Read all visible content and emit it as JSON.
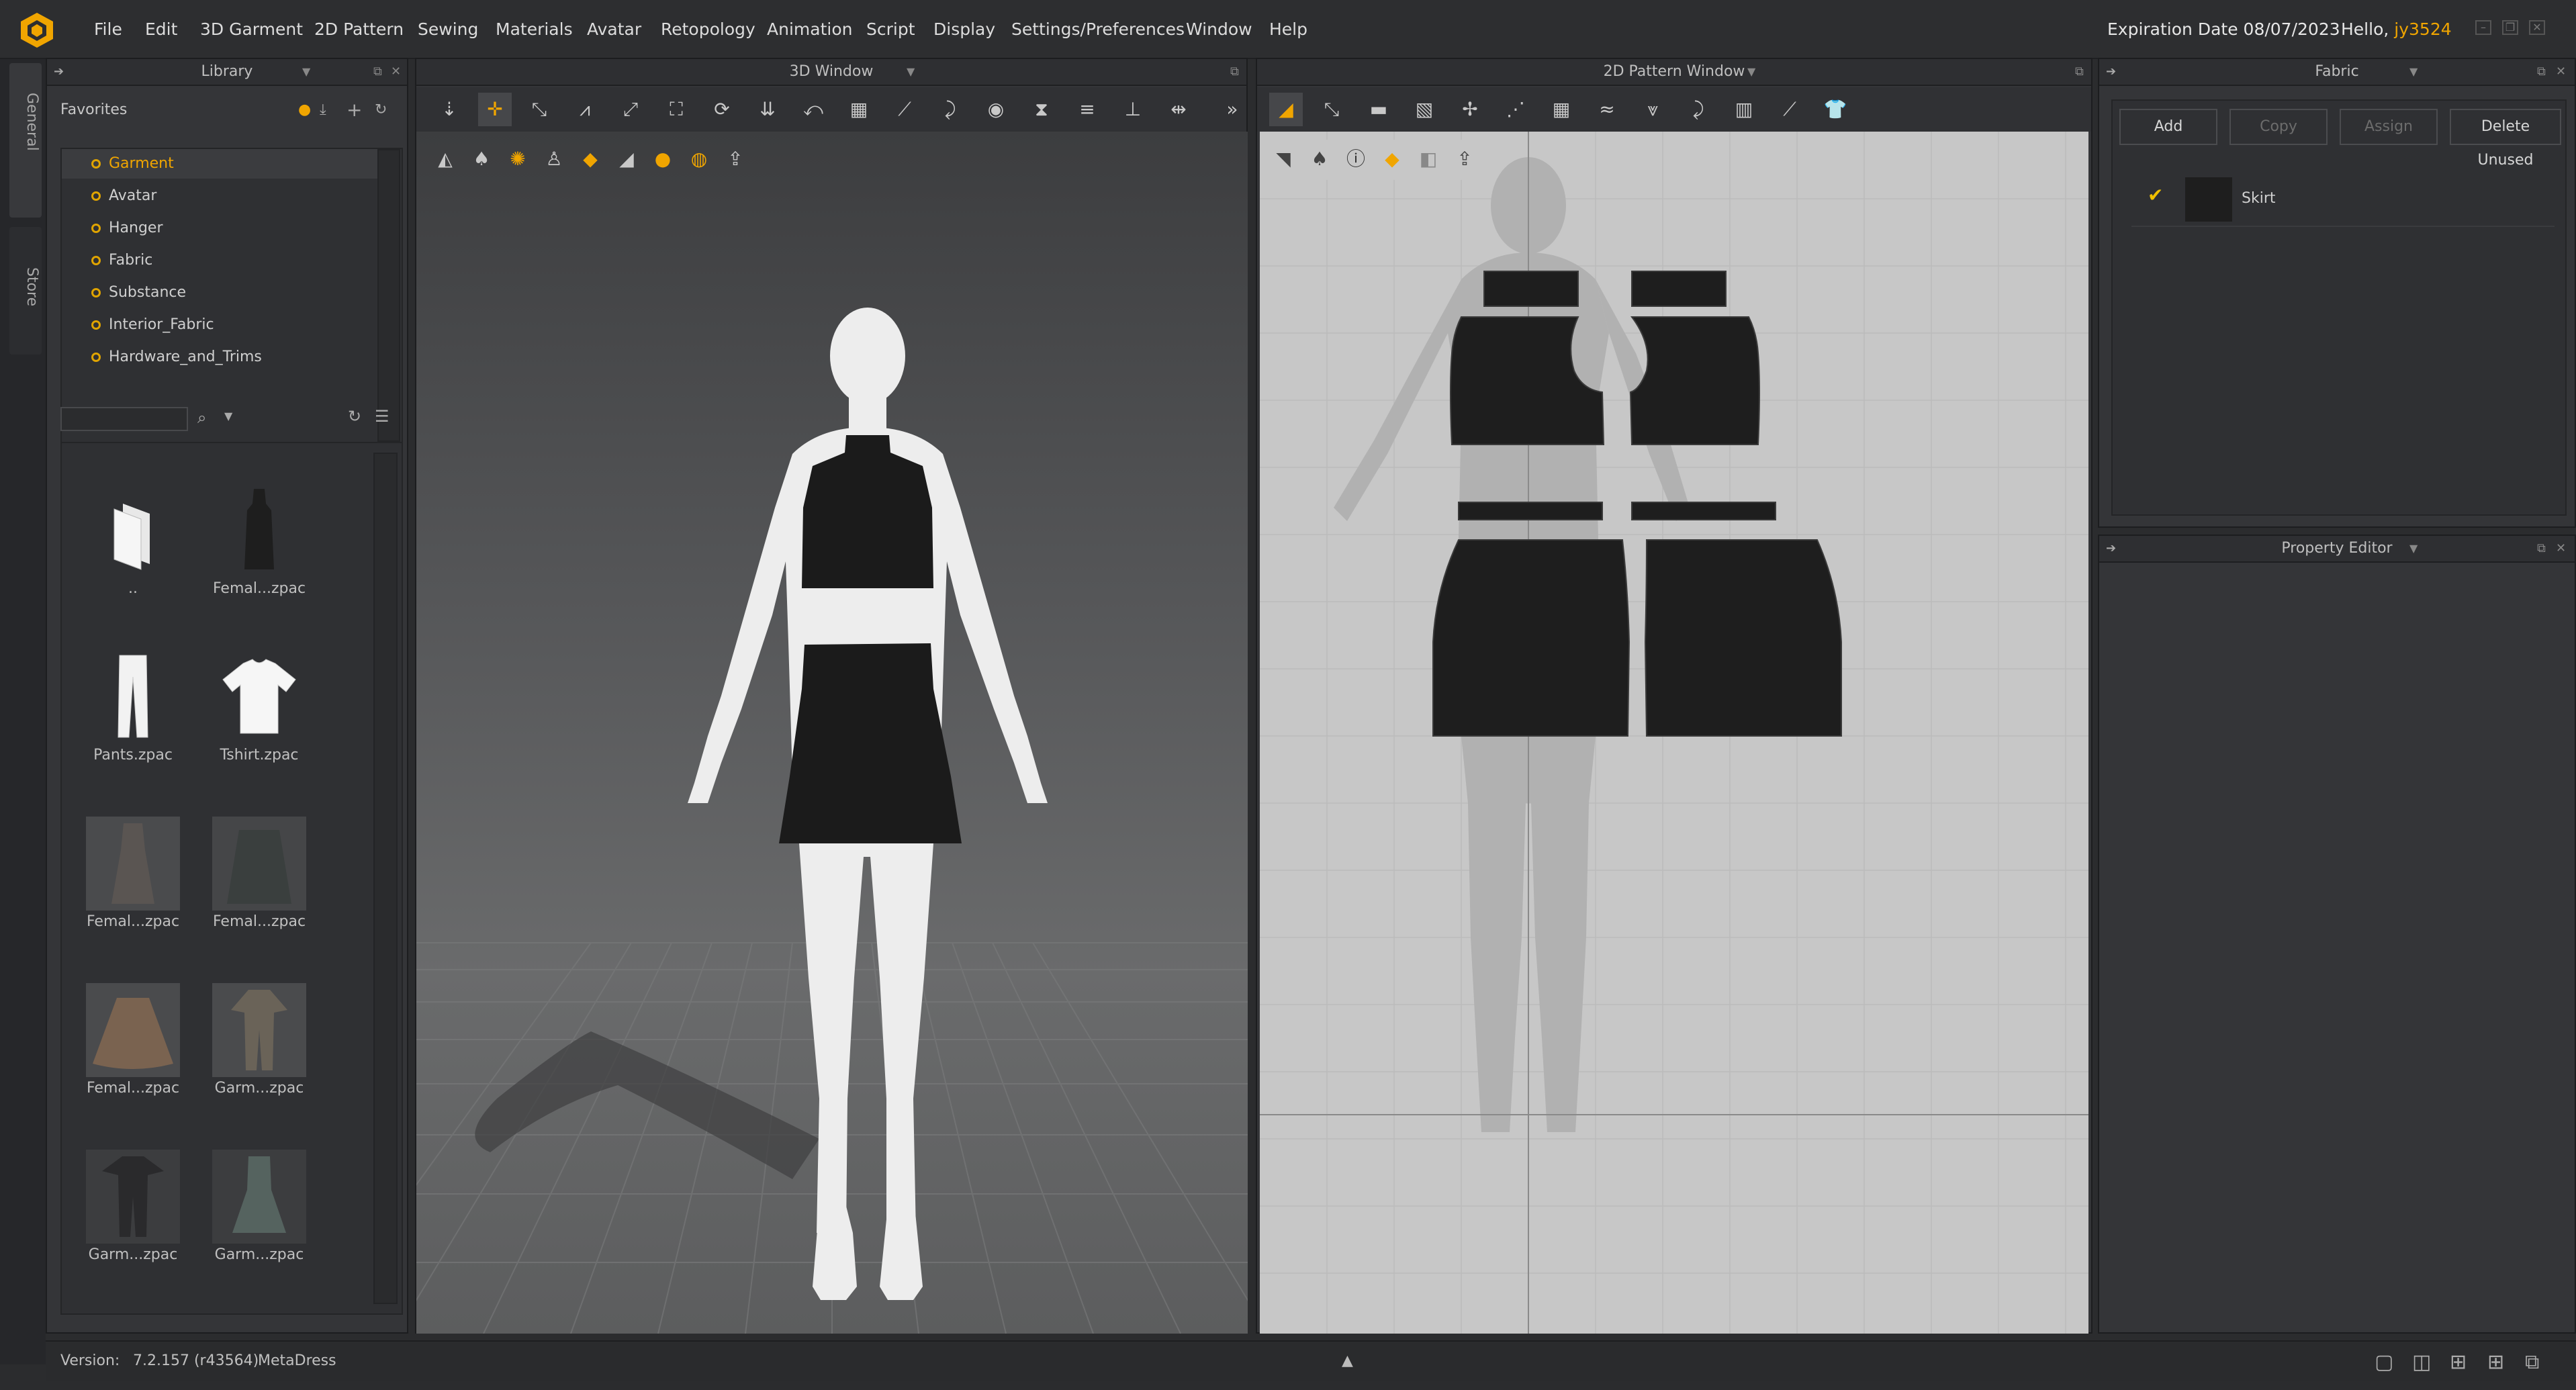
{
  "menubar": {
    "items": [
      "File",
      "Edit",
      "3D Garment",
      "2D Pattern",
      "Sewing",
      "Materials",
      "Avatar",
      "Retopology",
      "Animation",
      "Script",
      "Display",
      "Settings/Preferences",
      "Window",
      "Help"
    ],
    "expiration": "Expiration Date 08/07/2023",
    "hello_prefix": "Hello, ",
    "username": "jy3524"
  },
  "vertical_tabs": [
    "General",
    "Store"
  ],
  "library": {
    "title": "Library",
    "favorites_label": "Favorites",
    "tree": [
      "Garment",
      "Avatar",
      "Hanger",
      "Fabric",
      "Substance",
      "Interior_Fabric",
      "Hardware_and_Trims"
    ],
    "search_placeholder": "",
    "files": [
      {
        "label": "..",
        "icon": "folder-up-icon"
      },
      {
        "label": "Femal...zpac",
        "icon": "dress-dark-icon"
      },
      {
        "label": "Pants.zpac",
        "icon": "pants-icon"
      },
      {
        "label": "Tshirt.zpac",
        "icon": "tshirt-icon"
      },
      {
        "label": "Femal...zpac",
        "icon": "garment-thumb-icon"
      },
      {
        "label": "Femal...zpac",
        "icon": "garment-thumb-icon"
      },
      {
        "label": "Femal...zpac",
        "icon": "skirt-brown-icon"
      },
      {
        "label": "Garm...zpac",
        "icon": "jumpsuit-icon"
      },
      {
        "label": "Garm...zpac",
        "icon": "outfit-dark-icon"
      },
      {
        "label": "Garm...zpac",
        "icon": "dress-teal-icon"
      }
    ]
  },
  "window3d": {
    "title": "3D Window"
  },
  "window2d": {
    "title": "2D Pattern Window"
  },
  "fabric_panel": {
    "title": "Fabric",
    "buttons": {
      "add": "Add",
      "copy": "Copy",
      "assign": "Assign",
      "delete_unused": "Delete Unused"
    },
    "items": [
      {
        "name": "Skirt",
        "color": "#1e1e1e",
        "checked": true
      }
    ]
  },
  "property_editor": {
    "title": "Property Editor"
  },
  "status": {
    "version_label": "Version:",
    "version": "7.2.157 (r43564)",
    "product": "MetaDress"
  },
  "colors": {
    "accent": "#f0a500",
    "garment": "#1b1b1b",
    "panel": "#343538"
  }
}
